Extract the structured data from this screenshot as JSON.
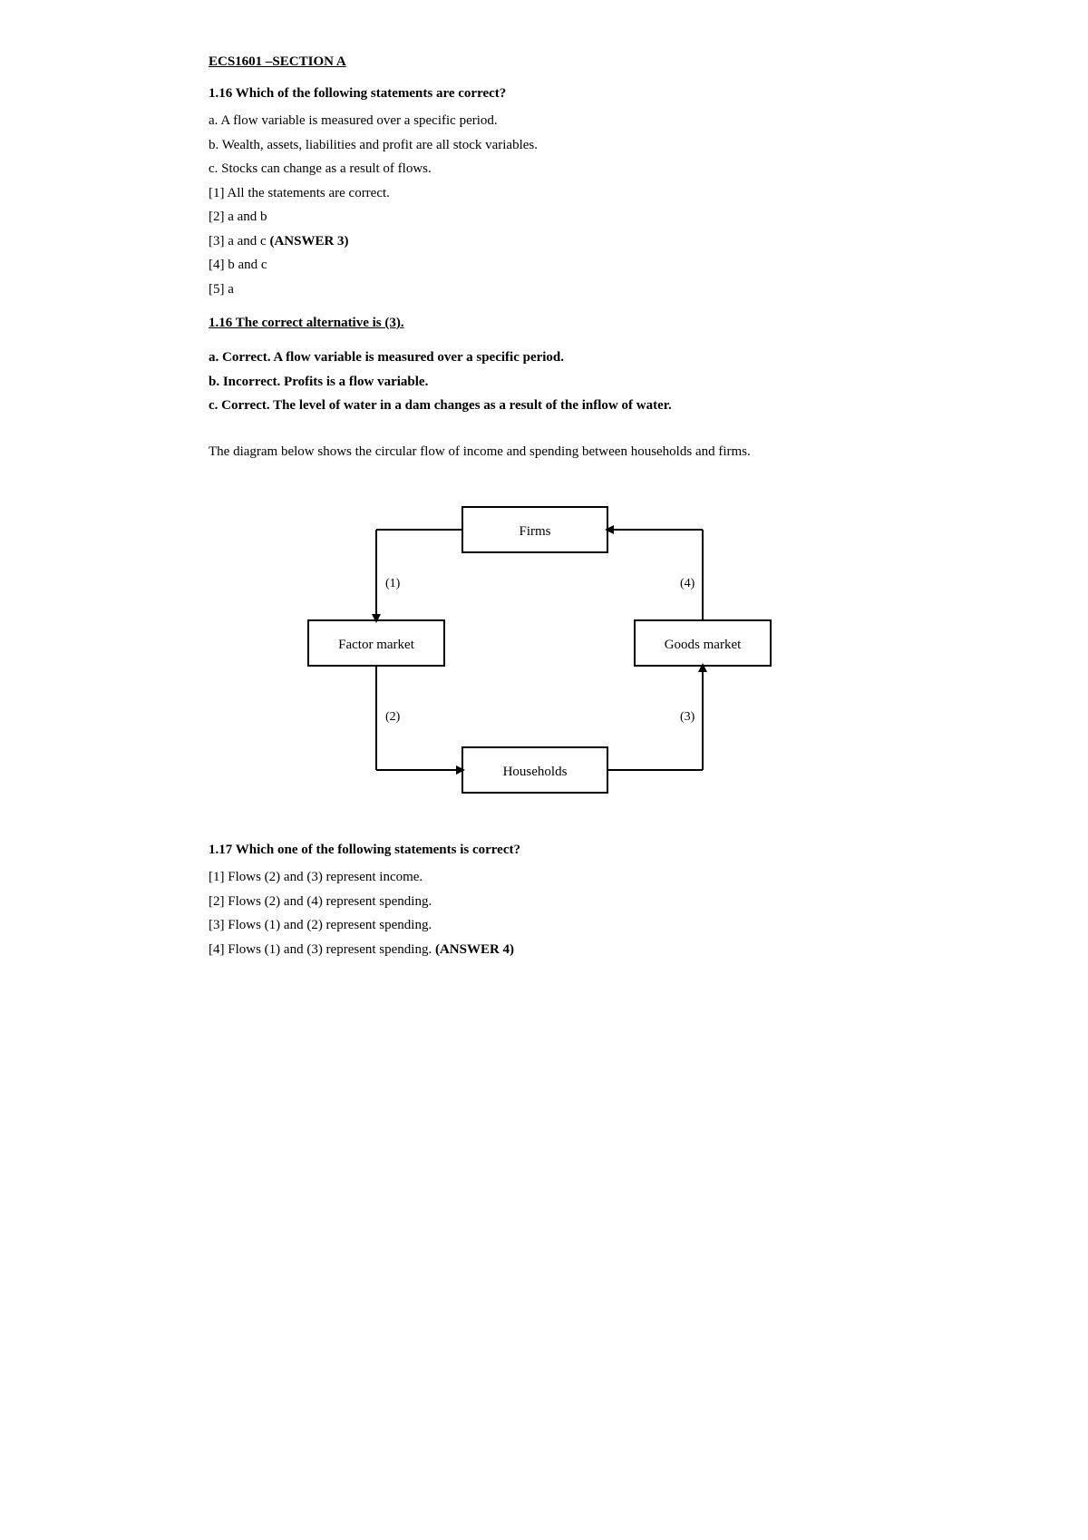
{
  "header": {
    "title": "ECS1601 –SECTION A"
  },
  "q116": {
    "number": "1.16",
    "heading": "Which of the following statements are correct?",
    "statements": [
      "a. A flow variable is measured over a specific period.",
      "b. Wealth, assets, liabilities and profit are all stock variables.",
      "c. Stocks can change as a result of flows.",
      "[1] All the statements are correct.",
      "[2] a and b",
      "[3] a and c",
      "[4] b and c",
      "[5] a"
    ],
    "answer_label": "(ANSWER 3)",
    "answer_note_heading": "1.16 The correct alternative is (3).",
    "explanations": [
      "a. Correct. A flow variable is measured over a specific period.",
      "b. Incorrect. Profits is a flow variable.",
      "c. Correct. The level of water in a dam changes as a result of the inflow of water."
    ],
    "diagram_intro": "The diagram below shows the circular flow of income and spending between households and firms."
  },
  "diagram": {
    "firms_label": "Firms",
    "factor_market_label": "Factor market",
    "goods_market_label": "Goods market",
    "households_label": "Households",
    "flow1": "(1)",
    "flow2": "(2)",
    "flow3": "(3)",
    "flow4": "(4)"
  },
  "q117": {
    "number": "1.17",
    "heading": "Which one of the following statements is correct?",
    "options": [
      "[1] Flows (2) and (3) represent income.",
      "[2] Flows (2) and (4) represent spending.",
      "[3] Flows (1) and (2) represent spending.",
      "[4] Flows (1) and (3) represent spending."
    ],
    "answer_label": "(ANSWER 4)"
  }
}
